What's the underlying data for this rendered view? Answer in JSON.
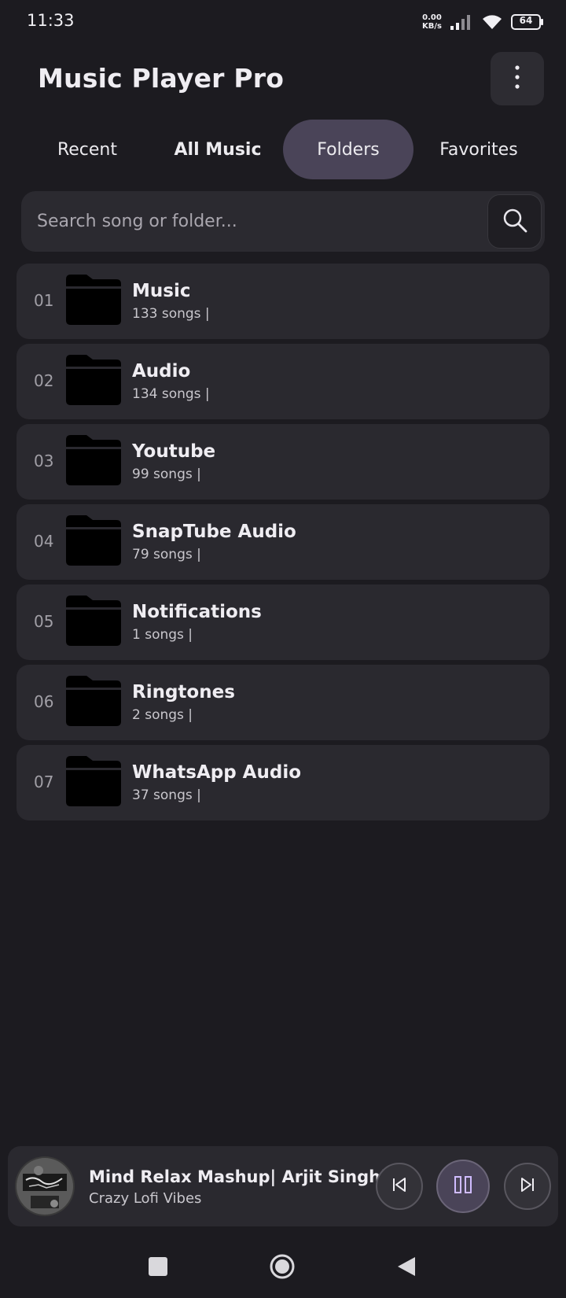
{
  "status_bar": {
    "time": "11:33",
    "net_speed_value": "0.00",
    "net_speed_unit": "KB/s",
    "battery": "64"
  },
  "header": {
    "title": "Music Player Pro",
    "menu_icon": "more-vertical-icon"
  },
  "tabs": [
    {
      "label": "Recent",
      "active": false
    },
    {
      "label": "All Music",
      "active": false
    },
    {
      "label": "Folders",
      "active": true
    },
    {
      "label": "Favorites",
      "active": false
    }
  ],
  "search": {
    "placeholder": "Search song or folder...",
    "value": "",
    "icon": "search-icon"
  },
  "folders": [
    {
      "num": "01",
      "name": "Music",
      "count": "133 songs |"
    },
    {
      "num": "02",
      "name": "Audio",
      "count": "134 songs |"
    },
    {
      "num": "03",
      "name": "Youtube",
      "count": "99 songs |"
    },
    {
      "num": "04",
      "name": "SnapTube Audio",
      "count": "79 songs |"
    },
    {
      "num": "05",
      "name": "Notifications",
      "count": "1 songs |"
    },
    {
      "num": "06",
      "name": "Ringtones",
      "count": "2 songs |"
    },
    {
      "num": "07",
      "name": "WhatsApp Audio",
      "count": "37 songs |"
    }
  ],
  "player": {
    "title": "Mind Relax Mashup| Arjit Singh| Lofi...",
    "artist": "Crazy Lofi Vibes",
    "prev_icon": "skip-previous-icon",
    "pause_icon": "pause-icon",
    "next_icon": "skip-next-icon"
  },
  "colors": {
    "background": "#1c1b20",
    "card": "#2a292f",
    "active_tab": "#4a4458",
    "accent": "#d0bcff"
  }
}
